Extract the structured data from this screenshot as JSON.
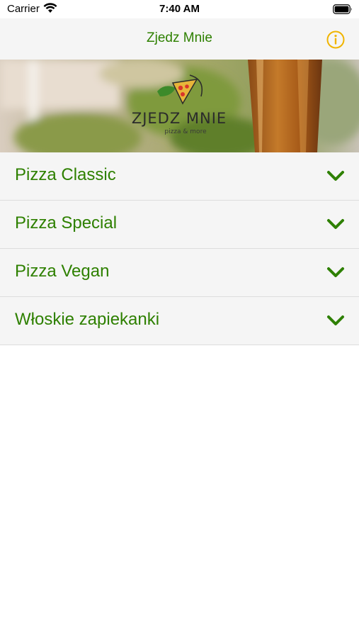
{
  "status_bar": {
    "carrier": "Carrier",
    "time": "7:40 AM"
  },
  "nav": {
    "title": "Zjedz Mnie",
    "info_icon": "info-circle-icon"
  },
  "banner": {
    "logo_text": "ZJEDZ MNIE",
    "logo_tagline": "pizza & more"
  },
  "menu": {
    "items": [
      {
        "label": "Pizza Classic",
        "icon": "chevron-down-icon"
      },
      {
        "label": "Pizza Special",
        "icon": "chevron-down-icon"
      },
      {
        "label": "Pizza Vegan",
        "icon": "chevron-down-icon"
      },
      {
        "label": "Włoskie zapiekanki",
        "icon": "chevron-down-icon"
      }
    ]
  },
  "colors": {
    "accent_green": "#2e8000",
    "info_yellow": "#f0b400",
    "row_background": "#f5f5f5",
    "separator": "#dddddd"
  }
}
